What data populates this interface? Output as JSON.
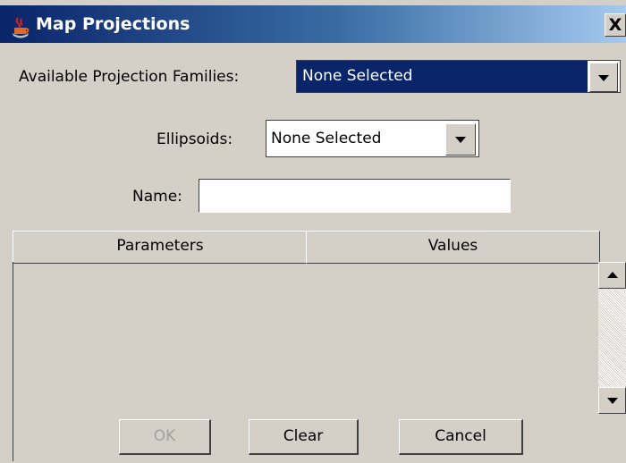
{
  "window": {
    "title": "Map Projections",
    "close_label": "X",
    "icon": "java-coffee-cup-icon"
  },
  "form": {
    "projection_label": "Available Projection Families:",
    "projection_value": "None Selected",
    "ellipsoid_label": "Ellipsoids:",
    "ellipsoid_value": "None Selected",
    "name_label": "Name:",
    "name_value": ""
  },
  "table": {
    "columns": [
      "Parameters",
      "Values"
    ],
    "rows": []
  },
  "buttons": {
    "ok": "OK",
    "clear": "Clear",
    "cancel": "Cancel"
  },
  "colors": {
    "window_bg": "#d4d0c8",
    "title_bar": "#0a246a",
    "selection": "#0a246a"
  }
}
